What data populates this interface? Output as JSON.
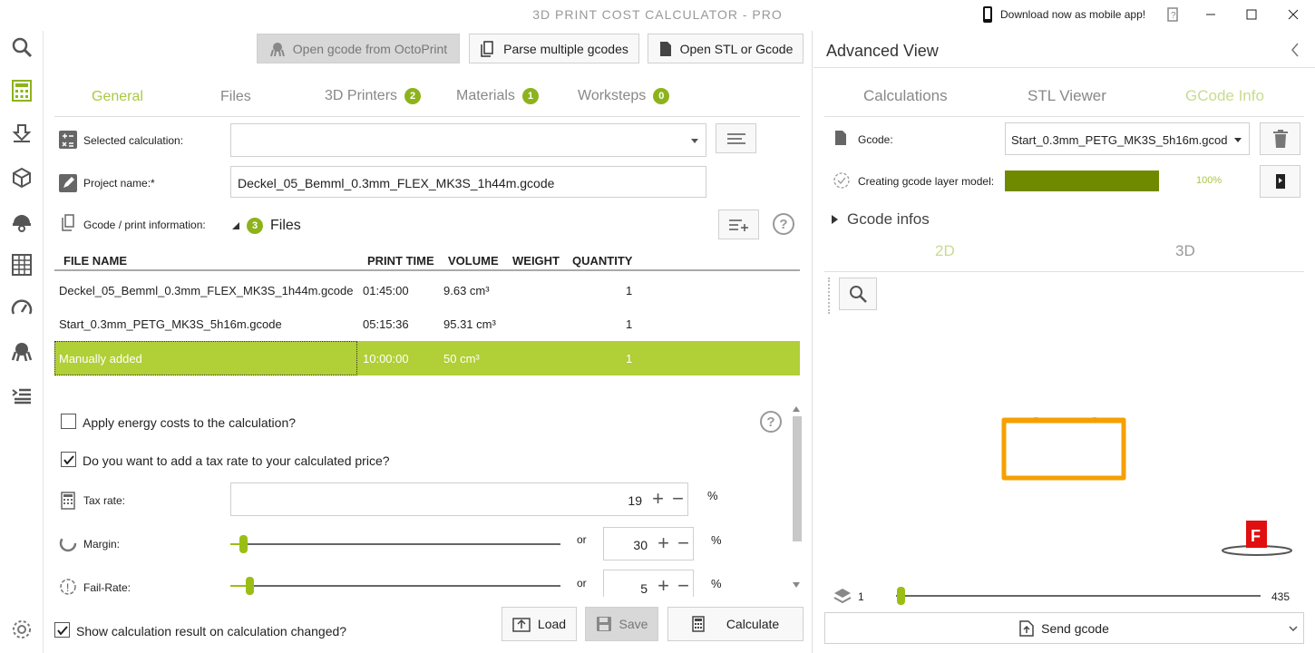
{
  "app": {
    "title": "3D PRINT COST CALCULATOR - PRO",
    "mobile_text": "Download now as mobile app!"
  },
  "sidebar": {
    "icons": [
      "search-icon",
      "calculator-icon",
      "import-icon",
      "cube-icon",
      "worker-helmet-icon",
      "spreadsheet-icon",
      "speedometer-icon",
      "octopus-icon",
      "list-icon",
      "gear-icon"
    ]
  },
  "toolbar": {
    "octoprint_label": "Open gcode from OctoPrint",
    "parse_label": "Parse multiple gcodes",
    "open_label": "Open STL or Gcode"
  },
  "tabs": [
    {
      "label": "General",
      "badge": ""
    },
    {
      "label": "Files",
      "badge": ""
    },
    {
      "label": "3D Printers",
      "badge": "2"
    },
    {
      "label": "Materials",
      "badge": "1"
    },
    {
      "label": "Worksteps",
      "badge": "0"
    }
  ],
  "form": {
    "selected_calc_label": "Selected calculation:",
    "selected_calc_value": "",
    "project_name_label": "Project name:*",
    "project_name_value": "Deckel_05_Bemml_0.3mm_FLEX_MK3S_1h44m.gcode",
    "gcode_info_label": "Gcode / print information:",
    "files_count": "3",
    "files_label": "Files"
  },
  "table": {
    "headers": [
      "FILE NAME",
      "PRINT TIME",
      "VOLUME",
      "WEIGHT",
      "QUANTITY"
    ],
    "rows": [
      {
        "name": "Deckel_05_Bemml_0.3mm_FLEX_MK3S_1h44m.gcode",
        "time": "01:45:00",
        "volume": "9.63 cm³",
        "weight": "",
        "qty": "1"
      },
      {
        "name": "Start_0.3mm_PETG_MK3S_5h16m.gcode",
        "time": "05:15:36",
        "volume": "95.31 cm³",
        "weight": "",
        "qty": "1"
      },
      {
        "name": "Manually added",
        "time": "10:00:00",
        "volume": "50 cm³",
        "weight": "",
        "qty": "1"
      }
    ]
  },
  "options": {
    "energy_label": "Apply energy costs to the calculation?",
    "energy_checked": false,
    "tax_question": "Do you want to add a tax rate to your calculated price?",
    "tax_checked": true,
    "tax_rate_label": "Tax rate:",
    "tax_rate_value": "19",
    "percent": "%",
    "margin_label": "Margin:",
    "margin_value": "30",
    "fail_label": "Fail-Rate:",
    "fail_value": "5",
    "or_label": "or",
    "plus": "+",
    "minus": "−"
  },
  "footer": {
    "show_result_label": "Show calculation result on calculation changed?",
    "load_label": "Load",
    "save_label": "Save",
    "calculate_label": "Calculate"
  },
  "advanced": {
    "title": "Advanced View",
    "tabs": [
      "Calculations",
      "STL Viewer",
      "GCode Info"
    ],
    "gcode_label": "Gcode:",
    "gcode_value": "Start_0.3mm_PETG_MK3S_5h16m.gcod",
    "layer_model_label": "Creating gcode layer model:",
    "progress": 1.0,
    "progress_text": "100%",
    "gcode_infos_label": "Gcode infos",
    "view_tabs": [
      "2D",
      "3D"
    ],
    "layer_min": "1",
    "layer_max": "435",
    "send_label": "Send gcode",
    "f_marker": "F"
  },
  "colors": {
    "accent": "#b1cf36",
    "badge": "#8db31c",
    "progress": "#708a00",
    "model": "#f5a000",
    "marker": "#e01010"
  }
}
